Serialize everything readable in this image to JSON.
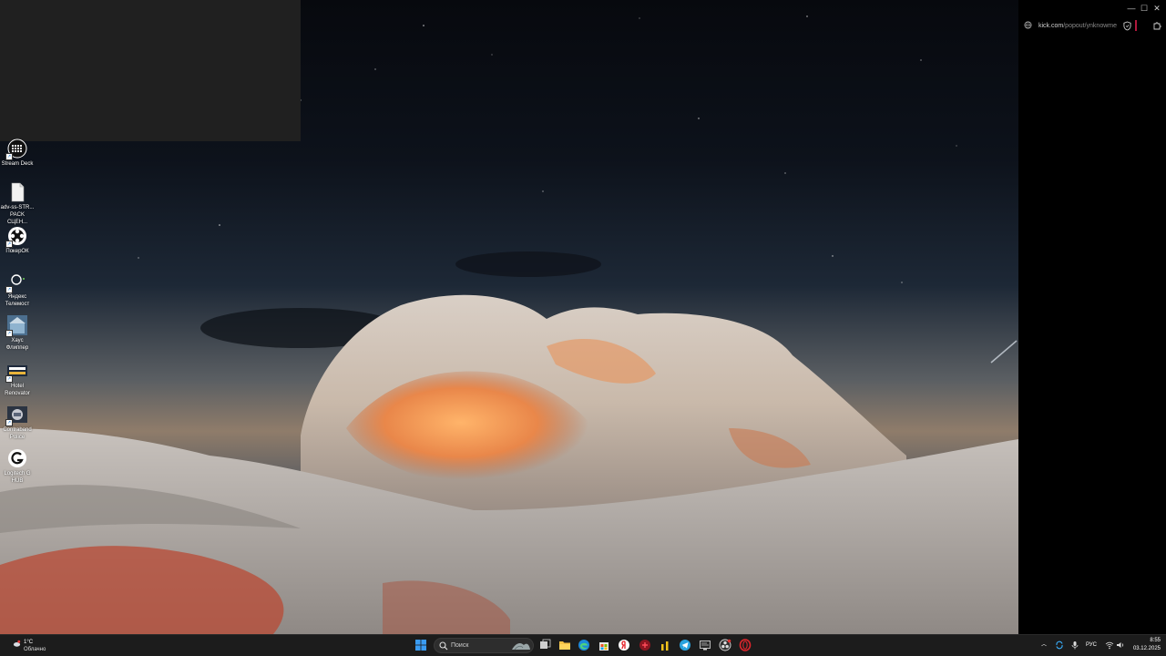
{
  "desktop": {
    "icons": [
      {
        "label": "Stream Deck",
        "icon": "stream-deck-icon"
      },
      {
        "label": "adv-ss-STR... PACK СЦЕН...",
        "icon": "file-icon"
      },
      {
        "label": "ПокерОК",
        "icon": "poker-icon"
      },
      {
        "label": "Яндекс Телемост",
        "icon": "telemost-icon"
      },
      {
        "label": "Хаус Флиппер",
        "icon": "house-flipper-icon"
      },
      {
        "label": "Hotel Renovator",
        "icon": "hotel-renovator-icon"
      },
      {
        "label": "Contraband Police",
        "icon": "contraband-police-icon"
      },
      {
        "label": "Logitech G HUB",
        "icon": "logitech-icon"
      }
    ]
  },
  "browser_popout": {
    "url_host": "kick.com",
    "url_path": "/popout/ynknowme",
    "accent_color": "#b0183c"
  },
  "taskbar": {
    "weather": {
      "temp": "1°C",
      "condition": "Облачно"
    },
    "search_placeholder": "Поиск",
    "apps": [
      "windows-start-icon",
      "task-view-icon",
      "file-explorer-icon",
      "edge-icon",
      "store-icon",
      "yandex-browser-icon",
      "game-launcher-icon",
      "bar-chart-icon",
      "telegram-icon",
      "monitor-app-icon",
      "obs-icon",
      "opera-icon"
    ],
    "tray": {
      "language": "РУС"
    },
    "clock": {
      "time": "8:55",
      "date": "03.12.2025"
    }
  }
}
